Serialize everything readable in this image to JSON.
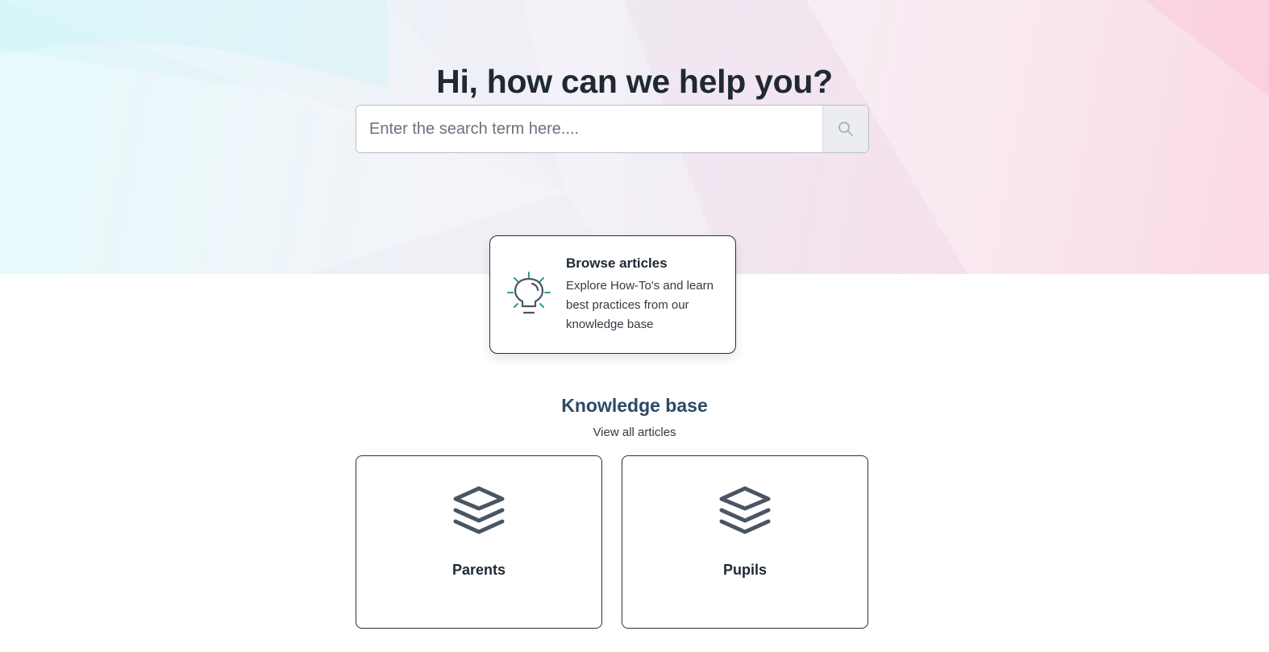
{
  "hero": {
    "title": "Hi, how can we help you?",
    "search": {
      "placeholder": "Enter the search term here....",
      "value": "",
      "button_icon": "search-icon"
    }
  },
  "browse": {
    "icon": "lightbulb-icon",
    "title": "Browse articles",
    "description": "Explore How-To's and learn best practices from our knowledge base"
  },
  "knowledge_base": {
    "title": "Knowledge base",
    "view_all": "View all articles",
    "categories": [
      {
        "label": "Parents",
        "icon": "layers-icon"
      },
      {
        "label": "Pupils",
        "icon": "layers-icon"
      }
    ]
  },
  "colors": {
    "heading": "#1f2933",
    "kb_title": "#2d4a63",
    "icon_dark": "#4a5563",
    "icon_accent": "#2a9d82",
    "card_border": "#2b2f36"
  }
}
